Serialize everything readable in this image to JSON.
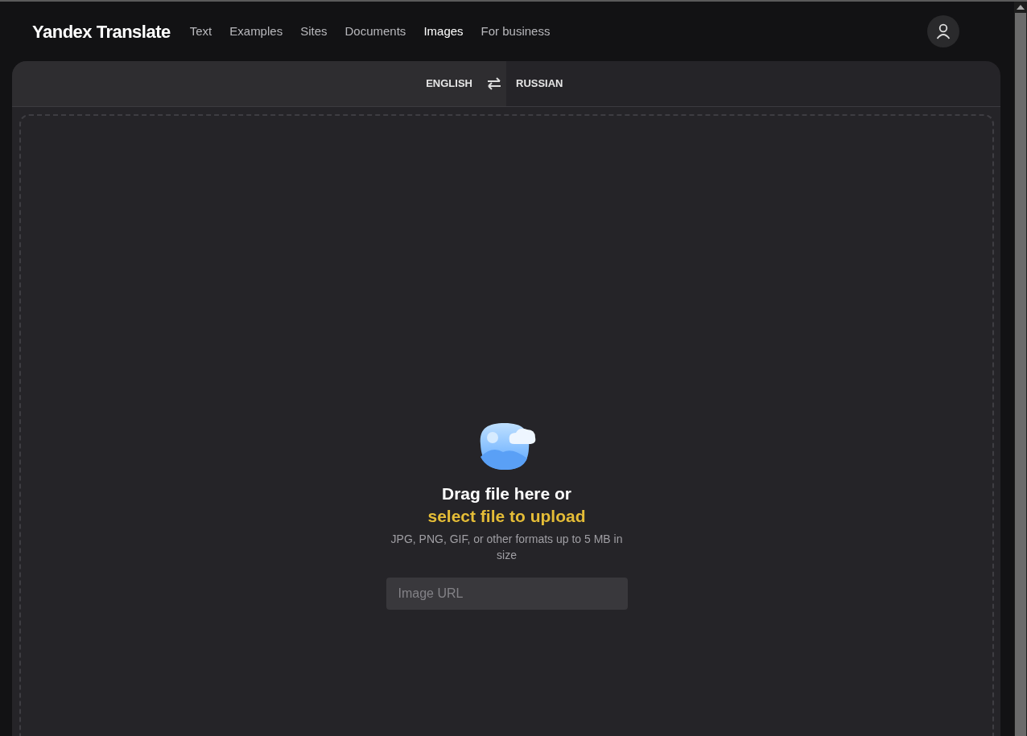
{
  "header": {
    "logo": "Yandex Translate",
    "nav": [
      {
        "label": "Text",
        "selected": false
      },
      {
        "label": "Examples",
        "selected": false
      },
      {
        "label": "Sites",
        "selected": false
      },
      {
        "label": "Documents",
        "selected": false
      },
      {
        "label": "Images",
        "selected": true
      },
      {
        "label": "For business",
        "selected": false
      }
    ]
  },
  "languages": {
    "source": "ENGLISH",
    "target": "RUSSIAN"
  },
  "upload": {
    "heading": "Drag file here or ",
    "link": "select file to upload",
    "hint": "JPG, PNG, GIF, or other formats up to 5 MB in size",
    "url_field": {
      "placeholder": "Image URL"
    }
  }
}
